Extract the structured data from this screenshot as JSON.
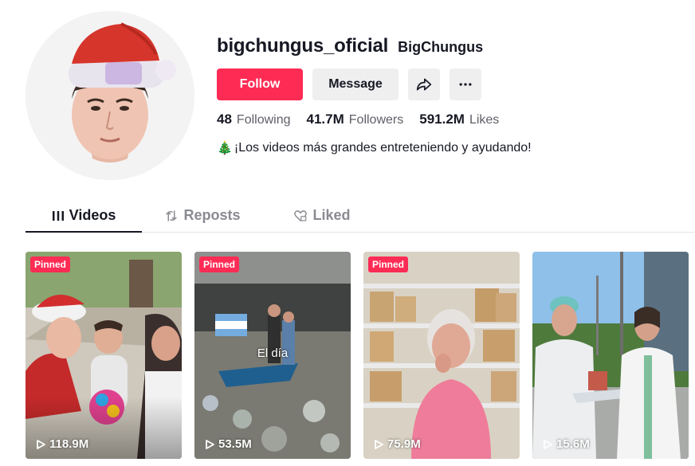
{
  "profile": {
    "username": "bigchungus_oficial",
    "nickname": "BigChungus",
    "avatar_icon": "santa-hat-avatar",
    "follow_label": "Follow",
    "message_label": "Message",
    "share_icon": "share-icon",
    "more_icon": "more-icon",
    "stats": [
      {
        "value": "48",
        "label": "Following"
      },
      {
        "value": "41.7M",
        "label": "Followers"
      },
      {
        "value": "591.2M",
        "label": "Likes"
      }
    ],
    "bio_emoji": "🎄",
    "bio_text": "¡Los videos más grandes entreteniendo y ayudando!"
  },
  "tabs": [
    {
      "label": "Videos",
      "icon": "grid-icon",
      "active": true
    },
    {
      "label": "Reposts",
      "icon": "repost-icon",
      "active": false
    },
    {
      "label": "Liked",
      "icon": "heart-lock-icon",
      "active": false
    }
  ],
  "videos": [
    {
      "pinned": "Pinned",
      "views": "118.9M",
      "caption": ""
    },
    {
      "pinned": "Pinned",
      "views": "53.5M",
      "caption": "El día"
    },
    {
      "pinned": "Pinned",
      "views": "75.9M",
      "caption": ""
    },
    {
      "pinned": "",
      "views": "15.6M",
      "caption": ""
    }
  ],
  "colors": {
    "accent": "#fe2c55",
    "text": "#161823",
    "muted": "#8a8b91",
    "button_bg": "#efeff0"
  }
}
